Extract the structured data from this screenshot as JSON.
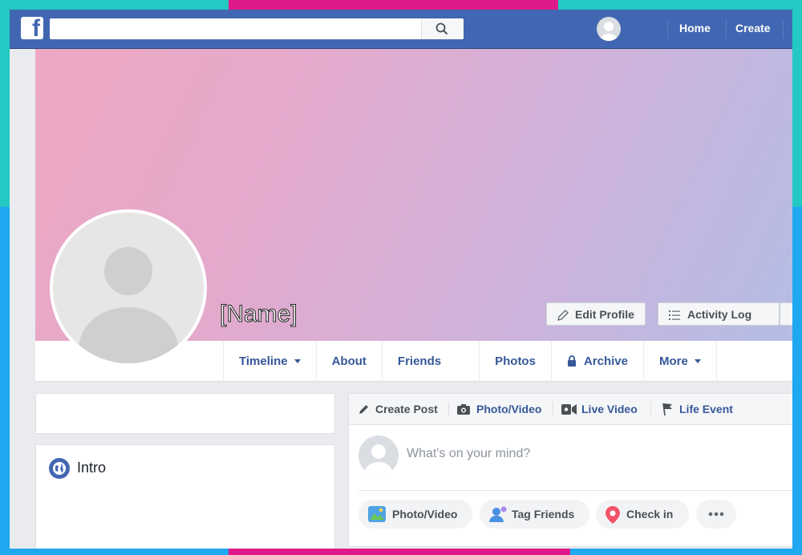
{
  "topbar": {
    "logo": "f",
    "search_placeholder": "",
    "nav_home": "Home",
    "nav_create": "Create"
  },
  "profile": {
    "name": "[Name]",
    "edit_profile": "Edit Profile",
    "activity_log": "Activity Log"
  },
  "tabs": [
    "Timeline",
    "About",
    "Friends",
    "Photos",
    "Archive",
    "More"
  ],
  "intro": {
    "label": "Intro"
  },
  "composer": {
    "create_post": "Create Post",
    "photo_video": "Photo/Video",
    "live_video": "Live Video",
    "life_event": "Life Event",
    "placeholder": "What's on your mind?",
    "action_photo_video": "Photo/Video",
    "action_tag_friends": "Tag Friends",
    "action_check_in": "Check in"
  },
  "colors": {
    "brand_blue": "#4267b2",
    "link_blue": "#365899",
    "frame_teal": "#23c9c2",
    "frame_pink": "#e0198a",
    "frame_blue": "#1fa8f0"
  }
}
